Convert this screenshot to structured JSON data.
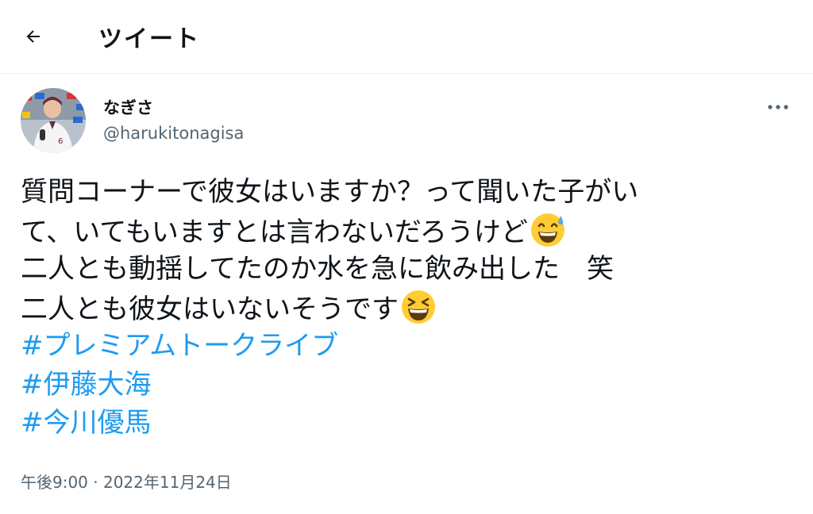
{
  "header": {
    "title": "ツイート",
    "back_icon": "arrow-left-icon"
  },
  "author": {
    "display_name": "なぎさ",
    "handle": "@harukitonagisa",
    "avatar_icon": "profile-photo"
  },
  "more_icon": "ellipsis-icon",
  "tweet": {
    "line1": "質問コーナーで彼女はいますか？って聞いた子がい",
    "line2": "て、いてもいますとは言わないだろうけど",
    "line2_emoji": "grinning-face-with-sweat-emoji",
    "line3": "二人とも動揺してたのか水を急に飲み出した　笑",
    "line4": "二人とも彼女はいないそうです",
    "line4_emoji": "grinning-squinting-face-emoji",
    "hashtags": [
      "#プレミアムトークライブ",
      "#伊藤大海",
      "#今川優馬"
    ]
  },
  "timestamp": "午後9:00 · 2022年11月24日",
  "colors": {
    "link": "#1d9bf0",
    "secondary_text": "#536471",
    "primary_text": "#0f1419"
  }
}
